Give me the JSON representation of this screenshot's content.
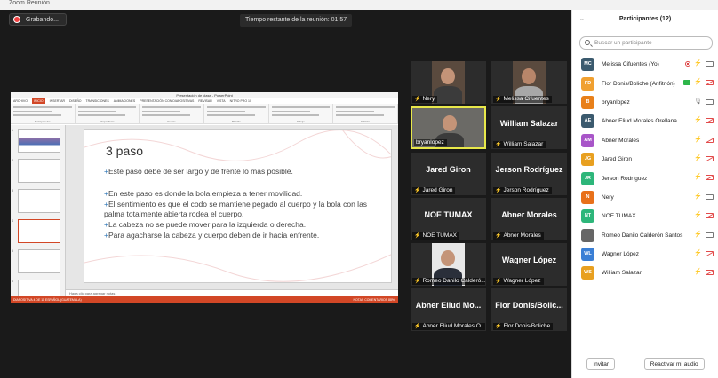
{
  "window": {
    "title": "Zoom Reunión"
  },
  "recording": {
    "label": "Grabando..."
  },
  "timer": {
    "label": "Tiempo restante de la reunión: 01:57"
  },
  "powerpoint": {
    "window_title": "Presentación de clase - PowerPoint",
    "tabs": [
      "ARCHIVO",
      "INICIO",
      "INSERTAR",
      "DISEÑO",
      "TRANSICIONES",
      "ANIMACIONES",
      "PRESENTACIÓN CON DIAPOSITIVAS",
      "REVISAR",
      "VISTA",
      "NITRO PRO 10"
    ],
    "ribbon_groups": [
      "Portapapeles",
      "Diapositivas",
      "Fuente",
      "Párrafo",
      "Dibujo",
      "Edición"
    ],
    "slide": {
      "title": "3 paso",
      "bullets": [
        "Este paso debe de ser largo y de frente lo más posible.",
        "En este paso es donde la bola empieza a tener movilidad.",
        "El sentimiento es que el codo se mantiene pegado al cuerpo y la bola con las palma totalmente abierta rodea el cuerpo.",
        "La cabeza no se puede mover para la izquierda o derecha.",
        "Para agacharse la cabeza y cuerpo deben de ir hacia enfrente."
      ]
    },
    "thumb_numbers": [
      "1",
      "2",
      "3",
      "4",
      "5",
      "6"
    ],
    "notes_placeholder": "Haga clic para agregar notas",
    "status_left": "DIAPOSITIVA 4 DE 11    ESPAÑOL (GUATEMALA)",
    "status_right": "NOTAS    COMENTARIOS    88%"
  },
  "tiles": [
    {
      "name": "Nery",
      "muted": true,
      "video": true
    },
    {
      "name": "Melissa Cifuentes",
      "muted": true,
      "video": true
    },
    {
      "name": "bryanlopez",
      "muted": false,
      "video": true,
      "active": true
    },
    {
      "name": "William Salazar",
      "muted": true,
      "video": false
    },
    {
      "name": "Jared Giron",
      "muted": true,
      "video": false
    },
    {
      "name": "Jerson Rodríguez",
      "muted": true,
      "video": false
    },
    {
      "name": "NOE TUMAX",
      "muted": true,
      "video": false
    },
    {
      "name": "Abner Morales",
      "muted": true,
      "video": false
    },
    {
      "name": "Romeo Danilo Calderó...",
      "muted": true,
      "video": true
    },
    {
      "name": "Wagner López",
      "muted": true,
      "video": false
    },
    {
      "name": "Abner Eliud Morales O...",
      "big": "Abner Eliud Mo...",
      "muted": true,
      "video": false
    },
    {
      "name": "Flor Donis/Boliche",
      "big": "Flor Donis/Bolic...",
      "muted": true,
      "video": false
    }
  ],
  "participants": {
    "title": "Participantes (12)",
    "search_placeholder": "Buscar un participante",
    "list": [
      {
        "initials": "MC",
        "name": "Melissa Cifuentes (Yo)",
        "color": "#3b5a6e",
        "rec": true,
        "mic": "muted",
        "cam": "on"
      },
      {
        "initials": "FD",
        "name": "Flor Donis/Boliche (Anfitrión)",
        "color": "#f0a030",
        "share": true,
        "mic": "muted",
        "cam": "off"
      },
      {
        "initials": "B",
        "name": "bryanlopez",
        "color": "#e8801a",
        "mic": "on",
        "cam": "on"
      },
      {
        "initials": "AE",
        "name": "Abner Eliud Morales Orellana",
        "color": "#3b5a6e",
        "mic": "muted",
        "cam": "off"
      },
      {
        "initials": "AM",
        "name": "Abner Morales",
        "color": "#a855c8",
        "mic": "muted",
        "cam": "off"
      },
      {
        "initials": "JG",
        "name": "Jared Giron",
        "color": "#e8a020",
        "mic": "muted",
        "cam": "off"
      },
      {
        "initials": "JR",
        "name": "Jerson Rodríguez",
        "color": "#2db67a",
        "mic": "muted",
        "cam": "off"
      },
      {
        "initials": "N",
        "name": "Nery",
        "color": "#e8701a",
        "mic": "muted",
        "cam": "on"
      },
      {
        "initials": "NT",
        "name": "NOE TUMAX",
        "color": "#2db67a",
        "mic": "muted",
        "cam": "off"
      },
      {
        "initials": "",
        "name": "Romeo Danilo Calderón Santos",
        "color": "#666666",
        "photo": true,
        "mic": "muted",
        "cam": "on"
      },
      {
        "initials": "WL",
        "name": "Wagner López",
        "color": "#3a7fd5",
        "mic": "muted",
        "cam": "off"
      },
      {
        "initials": "WS",
        "name": "William Salazar",
        "color": "#e8a020",
        "mic": "muted",
        "cam": "off"
      }
    ],
    "invite_label": "Invitar",
    "unmute_label": "Reactivar mi audio"
  }
}
